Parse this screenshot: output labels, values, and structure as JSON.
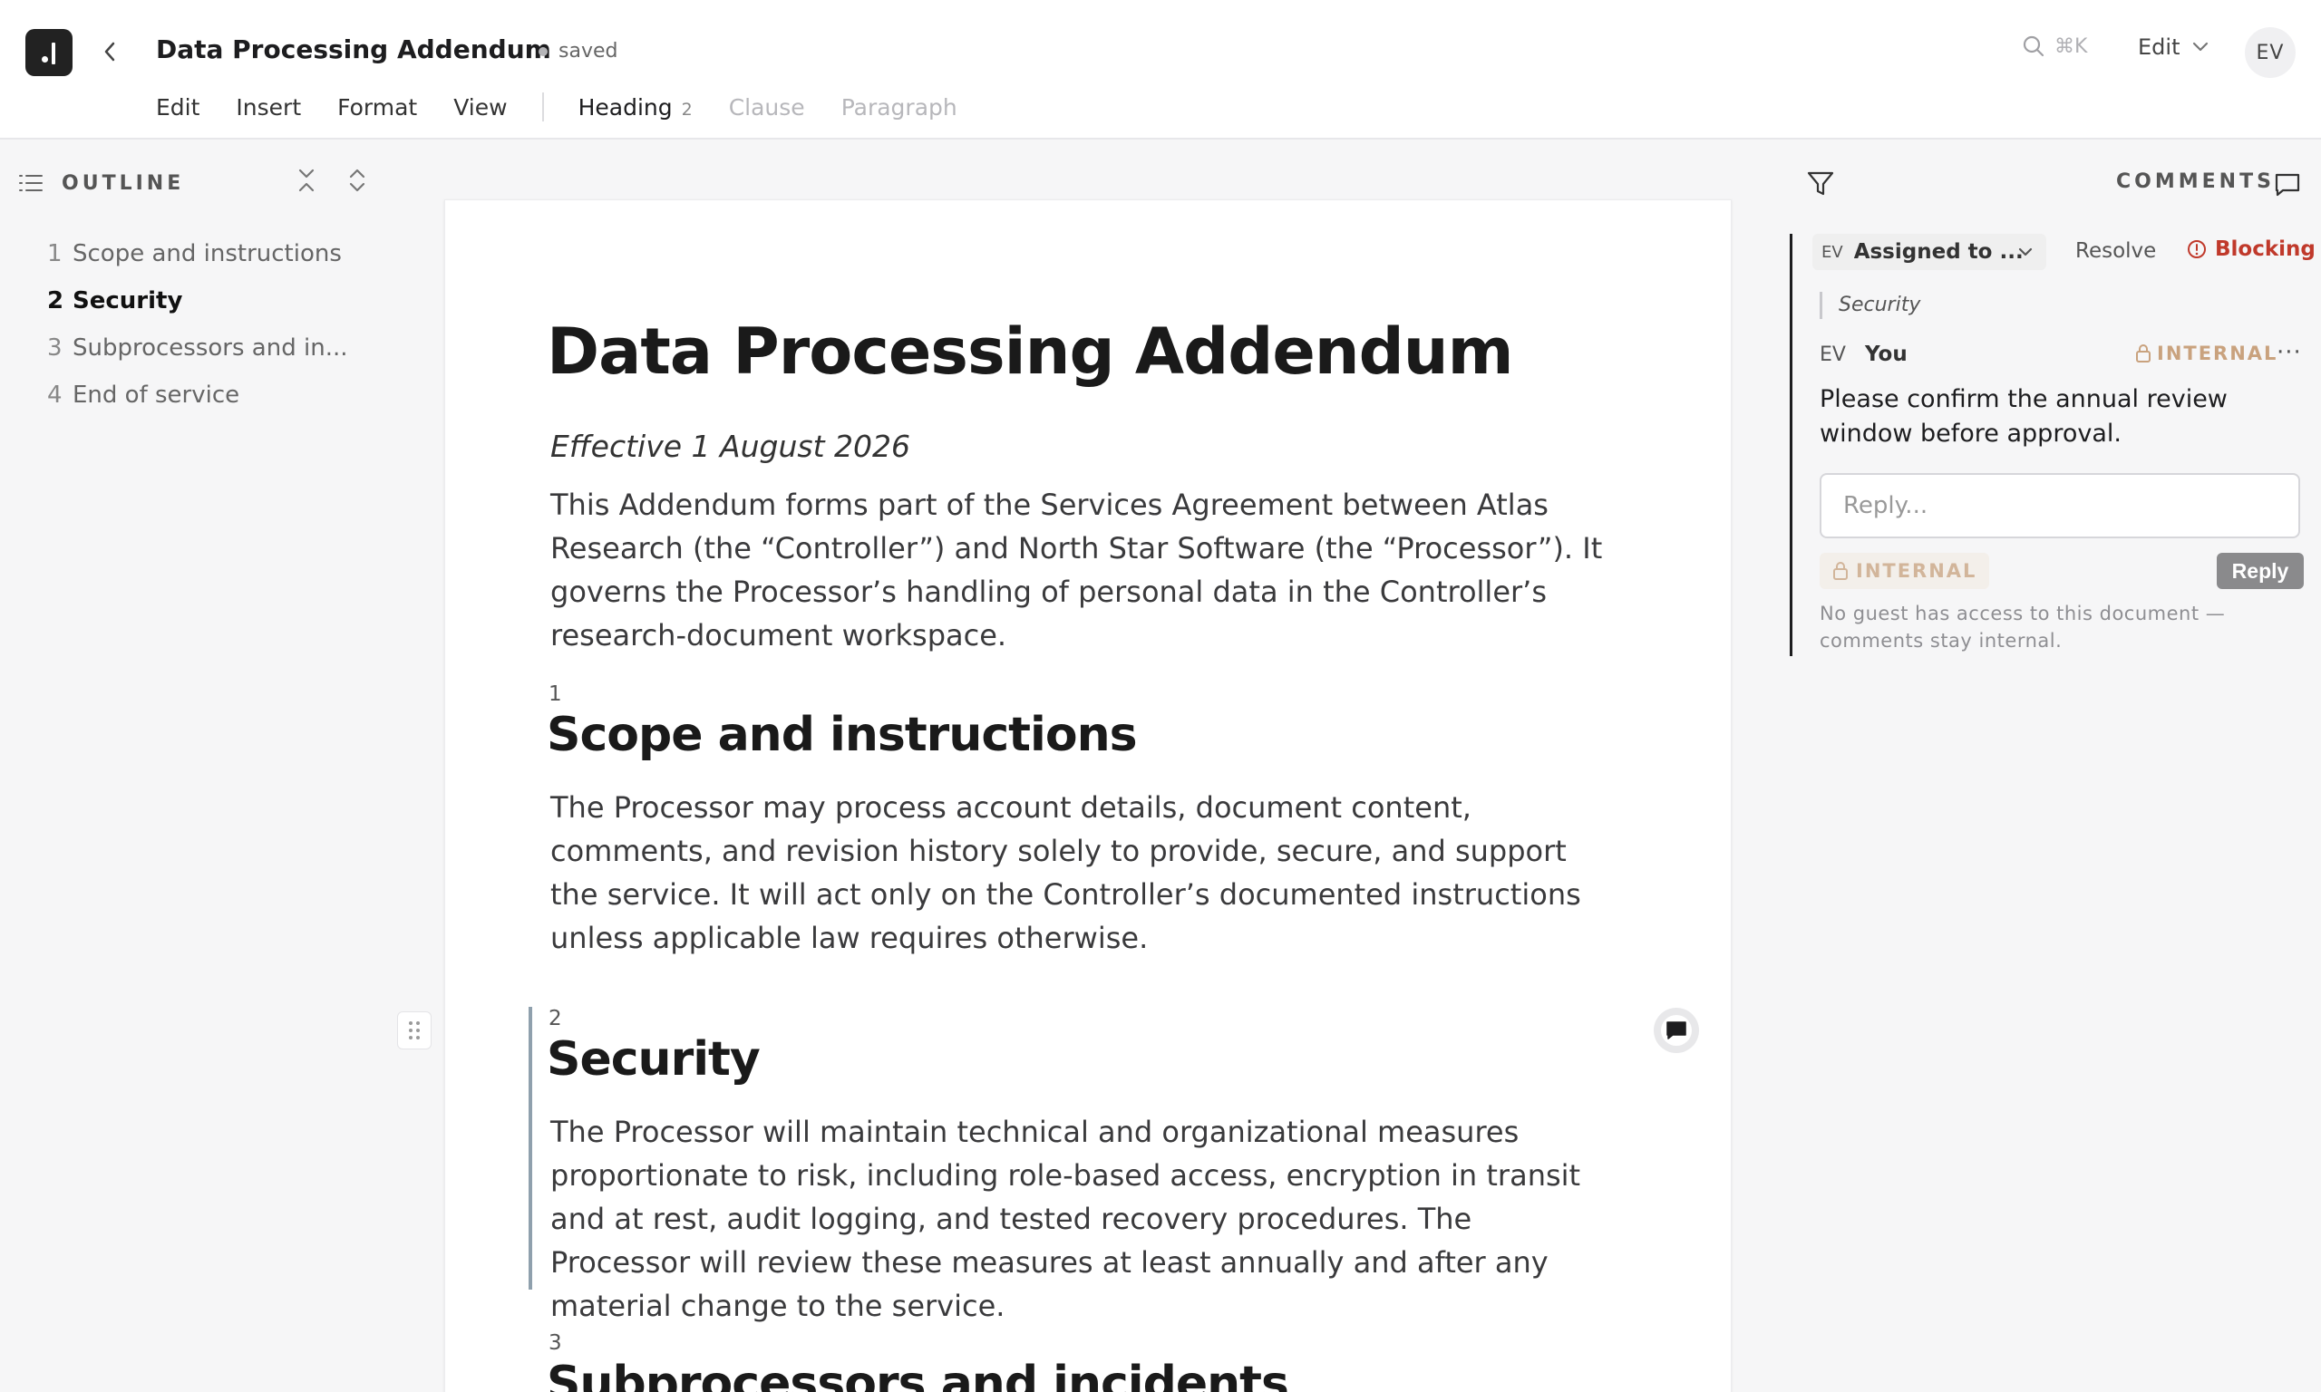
{
  "header": {
    "doc_title": "Data Processing Addendum",
    "save_status": "saved",
    "search_shortcut": "⌘K",
    "mode_label": "Edit",
    "user_initials": "EV"
  },
  "menu": {
    "items": [
      "Edit",
      "Insert",
      "Format",
      "View"
    ],
    "block_type": {
      "label": "Heading",
      "level": "2"
    },
    "block_options": [
      "Clause",
      "Paragraph"
    ]
  },
  "outline": {
    "title": "OUTLINE",
    "items": [
      {
        "num": "1",
        "label": "Scope and instructions",
        "active": false
      },
      {
        "num": "2",
        "label": "Security",
        "active": true
      },
      {
        "num": "3",
        "label": "Subprocessors and in...",
        "active": false
      },
      {
        "num": "4",
        "label": "End of service",
        "active": false
      }
    ]
  },
  "document": {
    "title": "Data Processing Addendum",
    "effective": "Effective 1 August 2026",
    "intro": "This Addendum forms part of the Services Agreement between Atlas Research (the “Controller”) and North Star Software (the “Processor”). It governs the Processor’s handling of personal data in the Controller’s research-document workspace.",
    "sections": [
      {
        "num": "1",
        "heading": "Scope and instructions",
        "body": "The Processor may process account details, document content, comments, and revision history solely to provide, secure, and support the service. It will act only on the Controller’s documented instructions unless applicable law requires otherwise."
      },
      {
        "num": "2",
        "heading": "Security",
        "body": "The Processor will maintain technical and organizational measures proportionate to risk, including role-based access, encryption in transit and at rest, audit logging, and tested recovery procedures. The Processor will review these measures at least annually and after any material change to the service."
      },
      {
        "num": "3",
        "heading": "Subprocessors and incidents",
        "body": ""
      }
    ]
  },
  "comments": {
    "title": "COMMENTS",
    "thread": {
      "assignee_initials": "EV",
      "assign_label": "Assigned to ...",
      "resolve_label": "Resolve",
      "blocking_label": "Blocking",
      "quote": "Security",
      "author_initials": "EV",
      "author_name": "You",
      "visibility": "INTERNAL",
      "body": "Please confirm the annual review window before approval.",
      "reply_placeholder": "Reply...",
      "reply_visibility": "INTERNAL",
      "reply_button": "Reply",
      "note": "No guest has access to this document — comments stay internal."
    }
  },
  "colors": {
    "accent_bar": "#8fa0ad",
    "blocking": "#c0392b",
    "internal_tag": "#c9a27e"
  }
}
